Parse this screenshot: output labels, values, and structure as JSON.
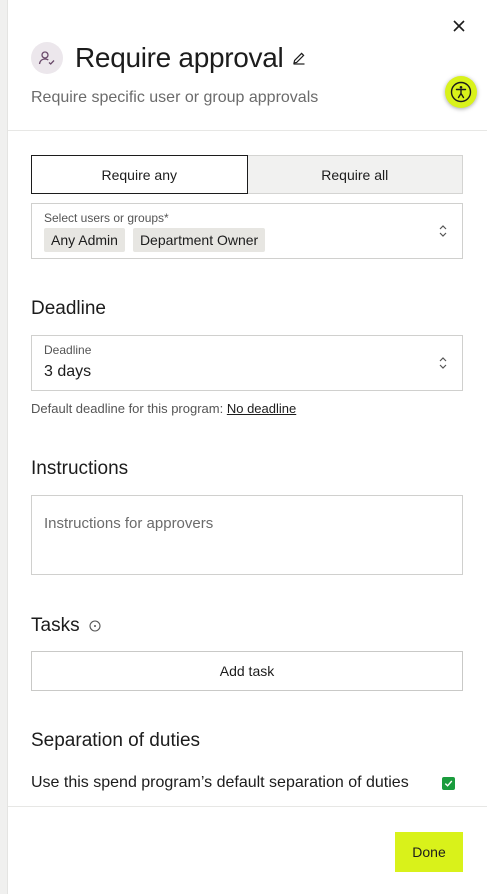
{
  "header": {
    "title": "Require approval",
    "subtitle": "Require specific user or group approvals",
    "icon": "user-check-icon",
    "close_icon": "close-icon",
    "edit_icon": "pencil-icon"
  },
  "accessibility_button": {
    "icon": "accessibility-icon",
    "color": "#d9f21a"
  },
  "approval_mode": {
    "options": [
      "Require any",
      "Require all"
    ],
    "selected": "Require any"
  },
  "approvers_field": {
    "label": "Select users or groups*",
    "chips": [
      "Any Admin",
      "Department Owner"
    ]
  },
  "deadline_section": {
    "heading": "Deadline",
    "field_label": "Deadline",
    "value": "3 days",
    "helper_prefix": "Default deadline for this program:",
    "helper_link": "No deadline"
  },
  "instructions_section": {
    "heading": "Instructions",
    "placeholder": "Instructions for approvers"
  },
  "tasks_section": {
    "heading": "Tasks",
    "add_button": "Add task"
  },
  "separation_section": {
    "heading": "Separation of duties",
    "checkbox_label": "Use this spend program’s default separation of duties",
    "checked": true,
    "check_color": "#1a9c3d"
  },
  "footer": {
    "done_label": "Done",
    "accent": "#d9f21a"
  }
}
